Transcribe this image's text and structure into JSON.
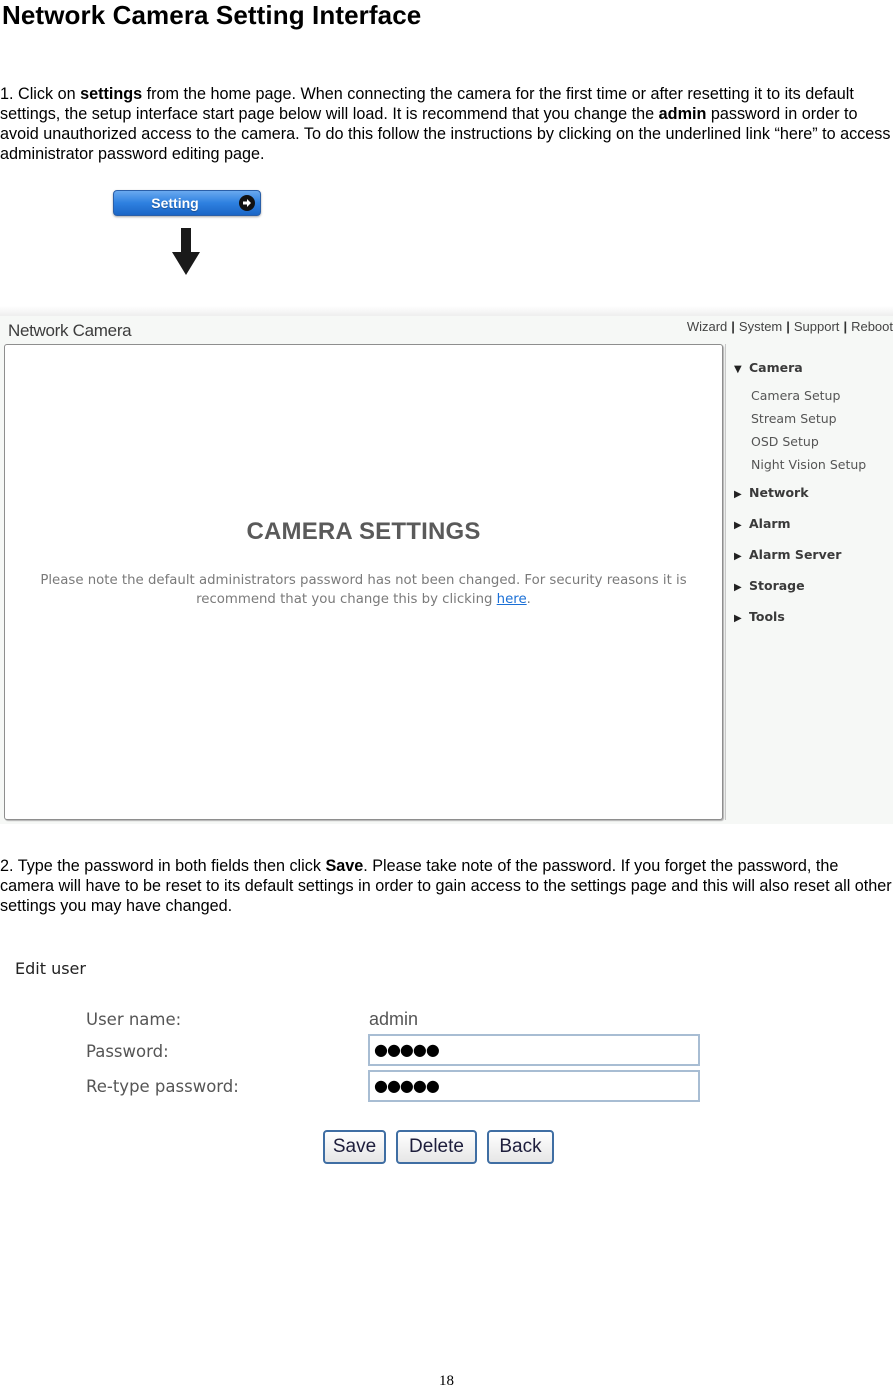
{
  "document": {
    "title": "Network Camera Setting Interface",
    "step1": {
      "parts": [
        "1. Click on ",
        "settings",
        " from the home page. When connecting the camera for the first time or after resetting it to its default settings, the setup interface start page below will load. It is recommend that you change the ",
        "admin",
        " password in order to avoid unauthorized access to the camera. To do this follow the instructions by clicking on the underlined link “here” to access administrator password editing page."
      ]
    },
    "step2": {
      "parts": [
        "2. Type the password in both fields then click ",
        "Save",
        ". Please take note of the password. If you forget the password, the camera will have to be reset to its default settings in order to gain access to the settings page and this will also reset all other settings you may have changed."
      ]
    },
    "page_number": "18"
  },
  "setting_button": {
    "label": "Setting",
    "icon": "arrow-right-circle-icon",
    "color": "#2e80e0"
  },
  "camera_ui": {
    "brand": "Network Camera",
    "top_links": [
      "Wizard",
      "System",
      "Support",
      "Reboot"
    ],
    "main": {
      "title": "CAMERA SETTINGS",
      "note_before_link": "Please note the default administrators password has not been changed. For security reasons it is recommend that you change this by clicking ",
      "link_text": "here",
      "note_after_link": ".",
      "link_color": "#1a6fd6"
    },
    "sidebar": {
      "sections": [
        {
          "label": "Camera",
          "expanded": true,
          "items": [
            "Camera Setup",
            "Stream Setup",
            "OSD Setup",
            "Night Vision Setup"
          ]
        },
        {
          "label": "Network",
          "expanded": false
        },
        {
          "label": "Alarm",
          "expanded": false
        },
        {
          "label": "Alarm Server",
          "expanded": false
        },
        {
          "label": "Storage",
          "expanded": false
        },
        {
          "label": "Tools",
          "expanded": false
        }
      ]
    }
  },
  "edit_user": {
    "title": "Edit user",
    "username_label": "User name:",
    "username_value": "admin",
    "password_label": "Password:",
    "password_value": "●●●●●",
    "retype_label": "Re-type password:",
    "retype_value": "●●●●●",
    "buttons": {
      "save": "Save",
      "delete": "Delete",
      "back": "Back"
    }
  }
}
